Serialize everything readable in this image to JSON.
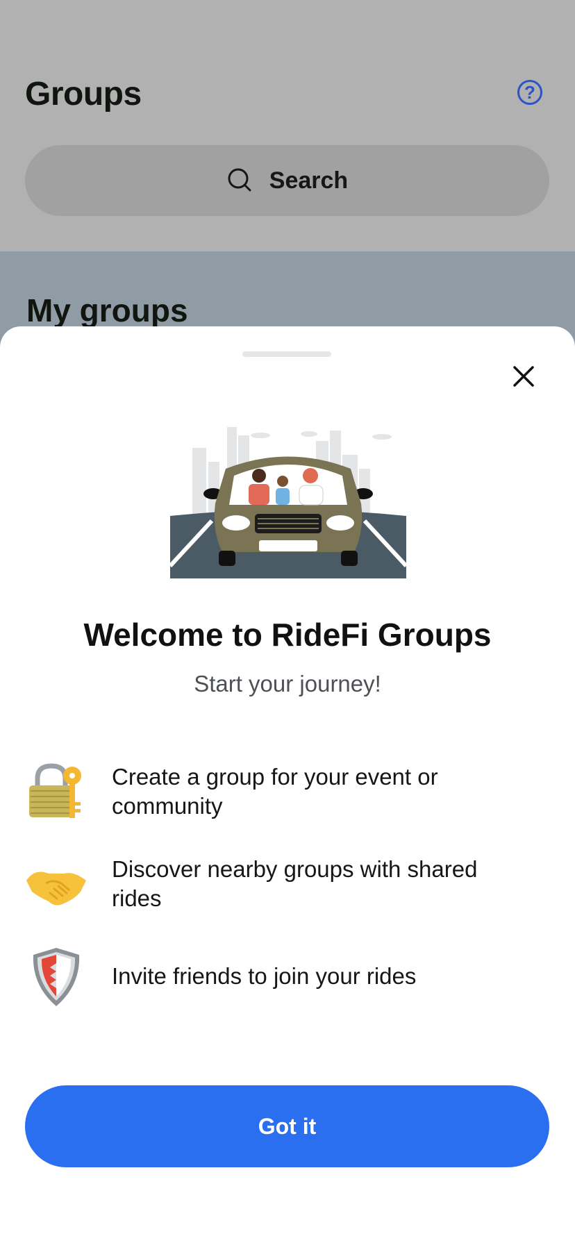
{
  "header": {
    "title": "Groups",
    "help_icon": "question-circle-icon",
    "search_placeholder": "Search"
  },
  "main": {
    "section_title": "My groups"
  },
  "welcome_sheet": {
    "title": "Welcome to RideFi Groups",
    "subtitle": "Start your journey!",
    "features": [
      {
        "icon": "lock-key-icon",
        "text": "Create a group for your event or community"
      },
      {
        "icon": "handshake-icon",
        "text": "Discover nearby groups with shared rides"
      },
      {
        "icon": "shield-icon",
        "text": "Invite friends to join your rides"
      }
    ],
    "primary_button": "Got it"
  },
  "colors": {
    "accent": "#2a6ff0",
    "help_icon": "#2b54c4"
  }
}
